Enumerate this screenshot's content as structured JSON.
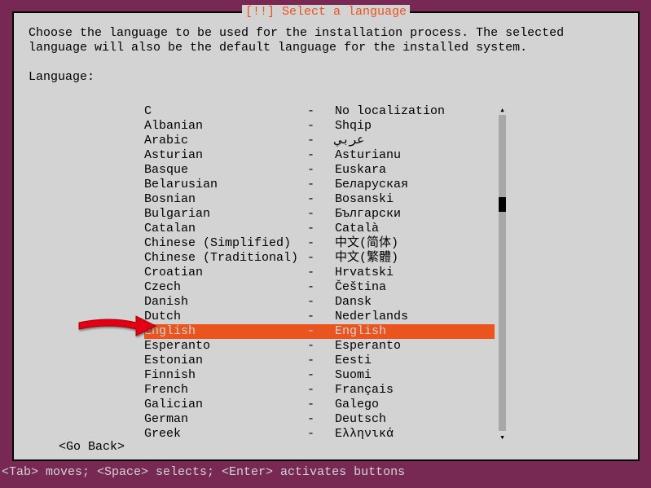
{
  "title": "[!!] Select a language",
  "instruction": "Choose the language to be used for the installation process. The selected language will also be the default language for the installed system.",
  "prompt": "Language:",
  "go_back_label": "<Go Back>",
  "footer_hint": "<Tab> moves; <Space> selects; <Enter> activates buttons",
  "selected_index": 15,
  "languages": [
    {
      "name": "C",
      "native": "No localization"
    },
    {
      "name": "Albanian",
      "native": "Shqip"
    },
    {
      "name": "Arabic",
      "native": "عربي"
    },
    {
      "name": "Asturian",
      "native": "Asturianu"
    },
    {
      "name": "Basque",
      "native": "Euskara"
    },
    {
      "name": "Belarusian",
      "native": "Беларуская"
    },
    {
      "name": "Bosnian",
      "native": "Bosanski"
    },
    {
      "name": "Bulgarian",
      "native": "Български"
    },
    {
      "name": "Catalan",
      "native": "Català"
    },
    {
      "name": "Chinese (Simplified)",
      "native": "中文(简体)"
    },
    {
      "name": "Chinese (Traditional)",
      "native": "中文(繁體)"
    },
    {
      "name": "Croatian",
      "native": "Hrvatski"
    },
    {
      "name": "Czech",
      "native": "Čeština"
    },
    {
      "name": "Danish",
      "native": "Dansk"
    },
    {
      "name": "Dutch",
      "native": "Nederlands"
    },
    {
      "name": "English",
      "native": "English"
    },
    {
      "name": "Esperanto",
      "native": "Esperanto"
    },
    {
      "name": "Estonian",
      "native": "Eesti"
    },
    {
      "name": "Finnish",
      "native": "Suomi"
    },
    {
      "name": "French",
      "native": "Français"
    },
    {
      "name": "Galician",
      "native": "Galego"
    },
    {
      "name": "German",
      "native": "Deutsch"
    },
    {
      "name": "Greek",
      "native": "Ελληνικά"
    }
  ]
}
